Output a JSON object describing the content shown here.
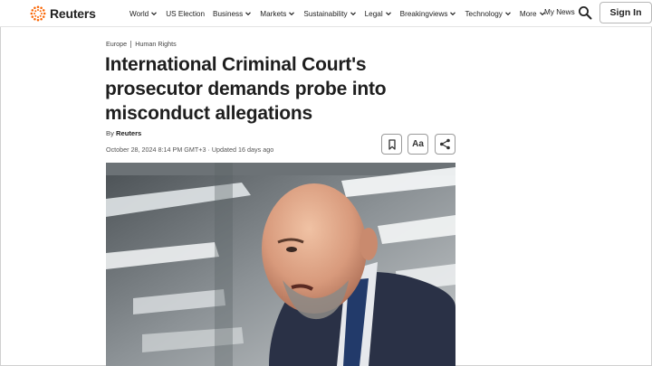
{
  "brand": {
    "name": "Reuters",
    "accent": "#fa6400"
  },
  "nav": {
    "items": [
      {
        "label": "World",
        "has_menu": true
      },
      {
        "label": "US Election",
        "has_menu": false
      },
      {
        "label": "Business",
        "has_menu": true
      },
      {
        "label": "Markets",
        "has_menu": true
      },
      {
        "label": "Sustainability",
        "has_menu": true
      },
      {
        "label": "Legal",
        "has_menu": true
      },
      {
        "label": "Breakingviews",
        "has_menu": true
      },
      {
        "label": "Technology",
        "has_menu": true
      },
      {
        "label": "More",
        "has_menu": true
      }
    ],
    "my_news": "My News",
    "search_icon": "search-icon",
    "sign_in": "Sign In"
  },
  "article": {
    "breadcrumb": [
      "Europe",
      "Human Rights"
    ],
    "headline": "International Criminal Court's prosecutor demands probe into misconduct allegations",
    "byline_prefix": "By",
    "byline_author": "Reuters",
    "dateline": "October 28, 2024 8:14 PM GMT+3 · Updated 16 days ago",
    "tools": {
      "bookmark_icon": "bookmark-icon",
      "font_size_label": "Aa",
      "share_icon": "share-icon"
    }
  }
}
